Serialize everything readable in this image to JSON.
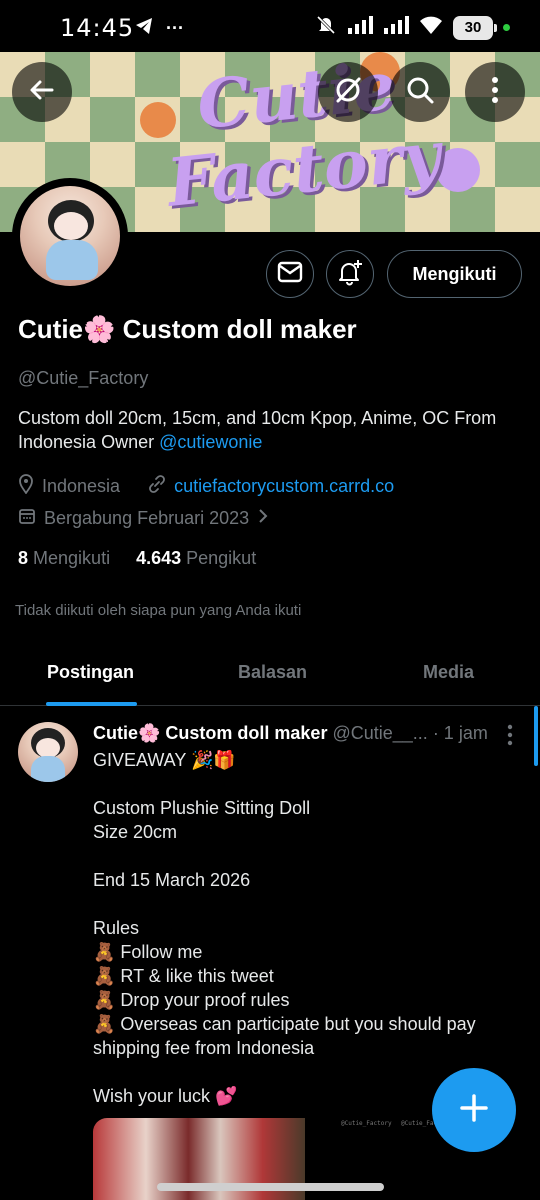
{
  "status_bar": {
    "time": "14:45",
    "more_glyph": "···",
    "battery": "30",
    "icons": [
      "telegram-icon",
      "mute-icon",
      "signal-icon",
      "signal-icon-2",
      "wifi-icon",
      "battery-icon"
    ]
  },
  "banner": {
    "title_line1": "Cutie",
    "title_line2": "Factory"
  },
  "top_buttons": {
    "back_icon": "arrow-left-icon",
    "grok_icon": "grok-icon",
    "search_icon": "search-icon",
    "more_icon": "more-vertical-icon"
  },
  "profile": {
    "display_name": "Cutie🌸 Custom doll maker",
    "handle": "@Cutie_Factory",
    "bio_text": "Custom doll 20cm, 15cm, and 10cm Kpop, Anime, OC From Indonesia Owner ",
    "bio_link": "@cutiewonie",
    "location": "Indonesia",
    "website": "cutiefactorycustom.carrd.co",
    "joined": "Bergabung Februari 2023",
    "following_count": "8",
    "following_label": "Mengikuti",
    "followers_count": "4.643",
    "followers_label": "Pengikut",
    "not_followed_text": "Tidak diikuti oleh siapa pun yang Anda ikuti"
  },
  "actions": {
    "message_icon": "mail-icon",
    "notify_icon": "bell-plus-icon",
    "follow_label": "Mengikuti"
  },
  "tabs": [
    {
      "label": "Postingan",
      "active": true
    },
    {
      "label": "Balasan",
      "active": false
    },
    {
      "label": "Media",
      "active": false
    }
  ],
  "post": {
    "author_name": "Cutie🌸 Custom doll maker",
    "author_handle": "@Cutie__...",
    "time": "· 1 jam",
    "lines": [
      "GIVEAWAY 🎉🎁",
      "",
      "Custom Plushie Sitting Doll",
      "Size 20cm",
      "",
      "End 15 March 2026",
      "",
      "Rules",
      "🧸 Follow me",
      "🧸 RT & like this tweet",
      "🧸 Drop your proof rules",
      "🧸 Overseas can participate but you should pay shipping fee from Indonesia",
      "",
      "Wish your luck 💕"
    ],
    "media_captions": [
      "@Cutie_Factory",
      "@Cutie_Factory"
    ]
  },
  "fab": {
    "icon": "plus-icon"
  },
  "colors": {
    "accent": "#1d9bf0",
    "background": "#000000",
    "secondary_text": "#71767b",
    "banner_lilac": "#c8a0f0",
    "banner_green": "#8fae82"
  }
}
